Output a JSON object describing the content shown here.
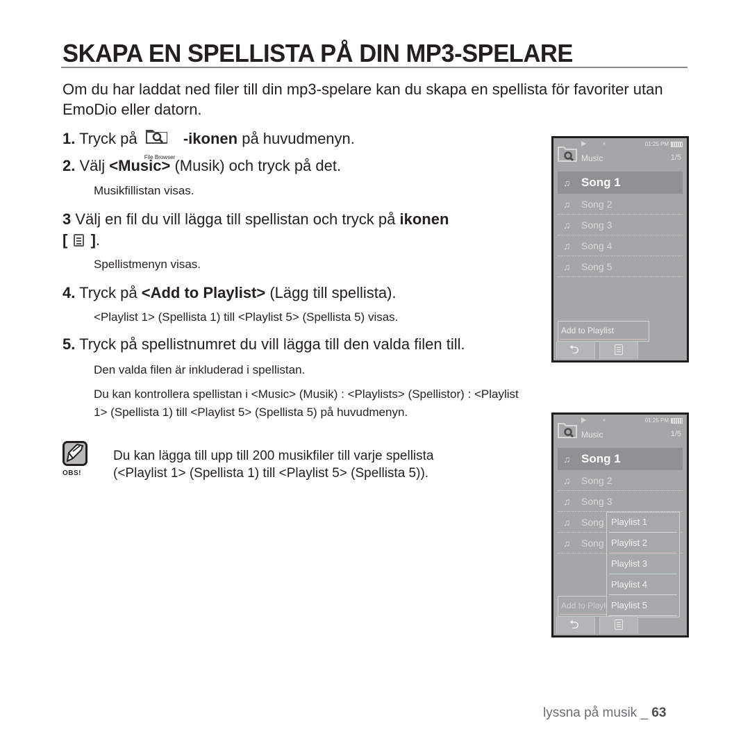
{
  "page": {
    "title": "SKAPA EN SPELLISTA PÅ DIN MP3-SPELARE",
    "intro": "Om du har laddat ned filer till din mp3-spelare kan du skapa en spellista för favoriter utan EmoDio eller datorn.",
    "steps": [
      {
        "num": "1.",
        "pre": "Tryck på",
        "icon_label": "File Browser",
        "bold": "-ikonen",
        "post": "på huvudmenyn."
      },
      {
        "num": "2.",
        "pre": "Välj",
        "bold": "<Music>",
        "post": "(Musik) och tryck på det.",
        "sub": "Musikfillistan visas."
      },
      {
        "num": "3",
        "pre": "Välj en fil du vill lägga till spellistan och tryck på",
        "bold": "ikonen",
        "bracket_open": "[",
        "bracket_close": "]",
        "end": ".",
        "sub": "Spellistmenyn visas."
      },
      {
        "num": "4.",
        "pre": "Tryck på",
        "bold": "<Add to Playlist>",
        "post": "(Lägg till spellista).",
        "sub": "<Playlist 1> (Spellista 1) till <Playlist 5> (Spellista 5) visas."
      },
      {
        "num": "5.",
        "pre": "Tryck på spellistnumret du vill lägga till den valda filen till.",
        "sub": "Den valda filen är inkluderad i spellistan.",
        "sub2_line1": "Du kan kontrollera spellistan i <Music> (Musik)  :  <Playlists> (Spellistor)  :  <Playlist",
        "sub2_line2": "1> (Spellista 1) till <Playlist 5> (Spellista 5) på huvudmenyn."
      }
    ],
    "note": {
      "label": "OBS!",
      "line1": "Du kan lägga till upp till 200 musikfiler till varje spellista",
      "line2": "(<Playlist 1> (Spellista 1) till <Playlist 5> (Spellista 5))."
    },
    "footer": {
      "section": "lyssna på musik _ ",
      "page_number": "63"
    }
  },
  "device": {
    "time": "01:25 PM",
    "bt_glyph": "∗",
    "title": "Music",
    "count": "1/5",
    "note_glyph": "♫",
    "songs": [
      "Song 1",
      "Song 2",
      "Song 3",
      "Song 4",
      "Song 5"
    ],
    "selected_index": 0,
    "context_button": "Add to Playlist",
    "back_glyph": "⮌",
    "playlists": [
      "Playlist 1",
      "Playlist 2",
      "Playlist 3",
      "Playlist 4",
      "Playlist 5"
    ]
  }
}
